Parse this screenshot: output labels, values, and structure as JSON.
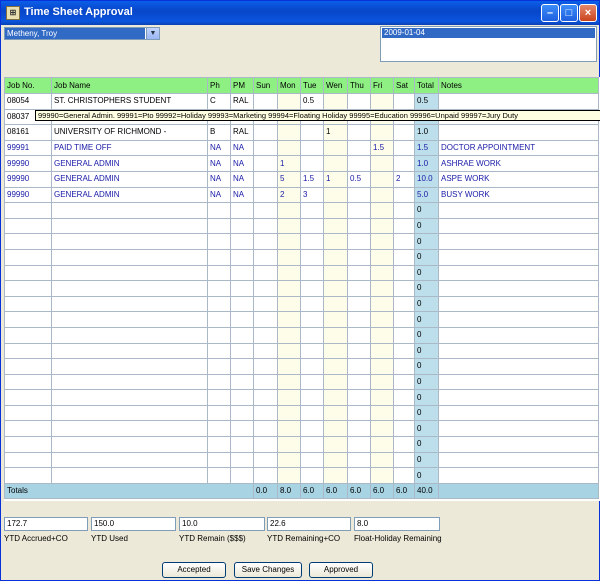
{
  "window": {
    "title": "Time Sheet Approval"
  },
  "employee": {
    "selected": "Metheny, Troy"
  },
  "week": {
    "selected_date": "2009-01-04"
  },
  "columns": [
    "Job No.",
    "Job Name",
    "Ph",
    "PM",
    "Sun",
    "Mon",
    "Tue",
    "Wen",
    "Thu",
    "Fri",
    "Sat",
    "Total",
    "Notes"
  ],
  "rows": [
    {
      "job": "08054",
      "name": "ST. CHRISTOPHERS STUDENT",
      "ph": "C",
      "pm": "RAL",
      "sun": "",
      "mon": "",
      "tue": "0.5",
      "wen": "",
      "thu": "",
      "fri": "",
      "sat": "",
      "total": "0.5",
      "notes": ""
    },
    {
      "job": "08037",
      "name": "",
      "ph": "",
      "pm": "",
      "sun": "",
      "mon": "",
      "tue": "",
      "wen": "",
      "thu": "",
      "fri": "",
      "sat": "",
      "total": "",
      "notes": ""
    },
    {
      "job": "08161",
      "name": "UNIVERSITY OF RICHMOND -",
      "ph": "B",
      "pm": "RAL",
      "sun": "",
      "mon": "",
      "tue": "",
      "wen": "1",
      "thu": "",
      "fri": "",
      "sat": "",
      "total": "1.0",
      "notes": ""
    },
    {
      "job": "99991",
      "name": "PAID TIME OFF",
      "ph": "NA",
      "pm": "NA",
      "sun": "",
      "mon": "",
      "tue": "",
      "wen": "",
      "thu": "",
      "fri": "1.5",
      "sat": "",
      "total": "1.5",
      "notes": "DOCTOR APPOINTMENT"
    },
    {
      "job": "99990",
      "name": "GENERAL ADMIN",
      "ph": "NA",
      "pm": "NA",
      "sun": "",
      "mon": "1",
      "tue": "",
      "wen": "",
      "thu": "",
      "fri": "",
      "sat": "",
      "total": "1.0",
      "notes": "ASHRAE WORK"
    },
    {
      "job": "99990",
      "name": "GENERAL ADMIN",
      "ph": "NA",
      "pm": "NA",
      "sun": "",
      "mon": "5",
      "tue": "1.5",
      "wen": "1",
      "thu": "0.5",
      "fri": "",
      "sat": "2",
      "total": "10.0",
      "notes": "ASPE WORK"
    },
    {
      "job": "99990",
      "name": "GENERAL ADMIN",
      "ph": "NA",
      "pm": "NA",
      "sun": "",
      "mon": "2",
      "tue": "3",
      "wen": "",
      "thu": "",
      "fri": "",
      "sat": "",
      "total": "5.0",
      "notes": "BUSY WORK"
    }
  ],
  "empty_row_total": "0",
  "empty_row_count": 18,
  "totals": {
    "label": "Totals",
    "sun": "0.0",
    "mon": "8.0",
    "tue": "6.0",
    "wen": "6.0",
    "thu": "6.0",
    "fri": "6.0",
    "sat": "6.0",
    "total": "40.0"
  },
  "tooltip": "99990=General Admin.  99991=Pto  99992=Holiday  99993=Marketing  99994=Floating Holiday  99995=Education  99996=Unpaid  99997=Jury Duty",
  "ytd": {
    "accrued_co": {
      "value": "172.7",
      "label": "YTD Accrued+CO"
    },
    "used": {
      "value": "150.0",
      "label": "YTD Used"
    },
    "remain": {
      "value": "10.0",
      "label": "YTD Remain ($$$)"
    },
    "remaining_co": {
      "value": "22.6",
      "label": "YTD Remaining+CO"
    },
    "float_holiday": {
      "value": "8.0",
      "label": "Float-Holiday Remaining"
    }
  },
  "buttons": {
    "accepted": "Accepted",
    "save": "Save Changes",
    "approved": "Approved"
  },
  "colors": {
    "header_green": "#8ef083",
    "total_blue": "#bcdfeb",
    "link_blue": "#1a1aa8"
  }
}
